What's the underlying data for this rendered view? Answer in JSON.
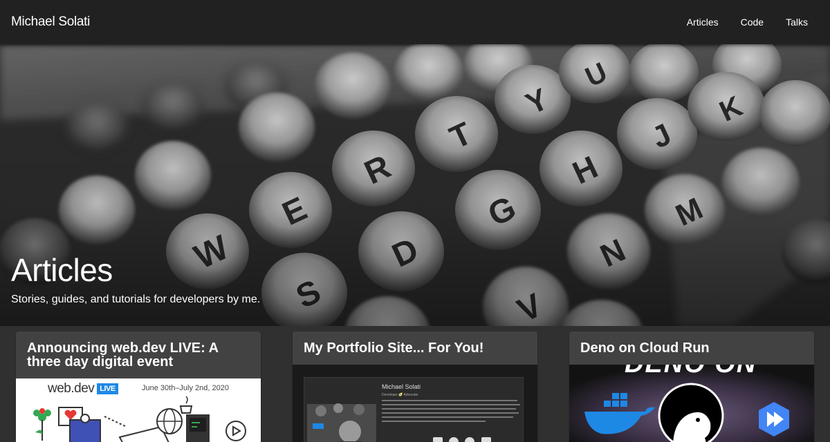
{
  "header": {
    "brand": "Michael Solati",
    "nav": [
      {
        "label": "Articles"
      },
      {
        "label": "Code"
      },
      {
        "label": "Talks"
      }
    ]
  },
  "hero": {
    "title": "Articles",
    "subtitle": "Stories, guides, and tutorials for developers by me."
  },
  "cards": [
    {
      "title": "Announcing web.dev LIVE: A three day digital event",
      "image_logo": "web.dev",
      "image_badge": "LIVE",
      "image_date": "June 30th–July 2nd, 2020"
    },
    {
      "title": "My Portfolio Site... For You!",
      "image_name": "Michael Solati",
      "image_role": "Developer 🥑 Advocate"
    },
    {
      "title": "Deno on Cloud Run",
      "image_text": "DENO ON"
    }
  ],
  "colors": {
    "topbar": "#212121",
    "background": "#303030",
    "card": "#424242",
    "live_blue": "#1e88e5"
  }
}
